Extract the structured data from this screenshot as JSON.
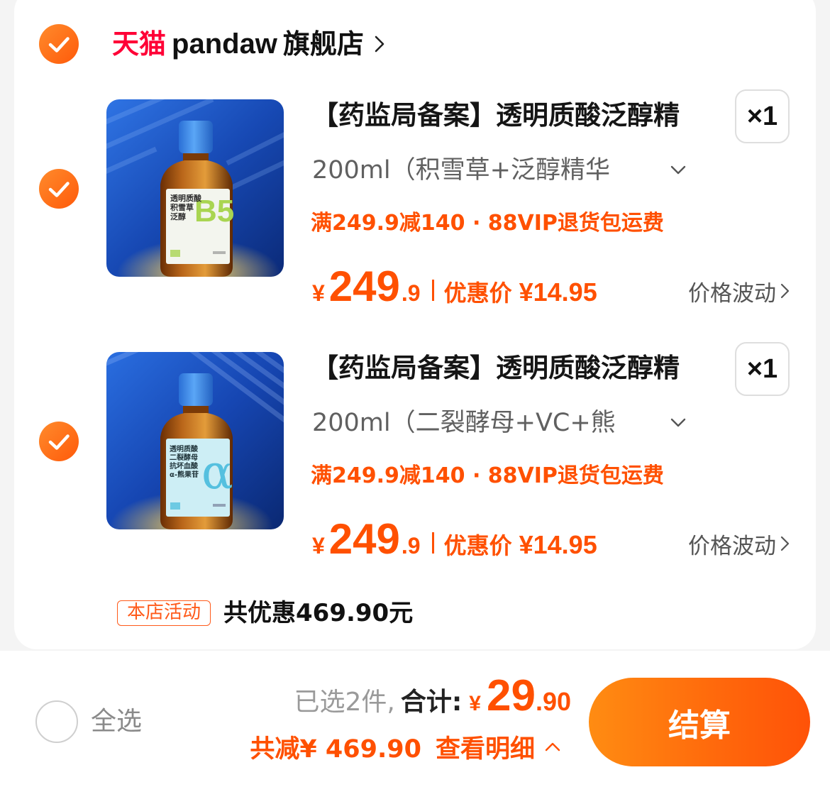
{
  "store": {
    "checked": true,
    "platform": "天猫",
    "name": "pandaw",
    "type": "旗舰店"
  },
  "items": [
    {
      "checked": true,
      "title": "【药监局备案】透明质酸泛醇精",
      "quantity": "×1",
      "spec": "200ml（积雪草+泛醇精华",
      "promo": "满249.9减140 · 88VIP退货包运费",
      "price": {
        "currency": "¥",
        "integer": "249",
        "decimal": ".9"
      },
      "discount": {
        "label": "优惠价",
        "price": "¥14.95"
      },
      "price_trend": "价格波动",
      "image_label": {
        "lines": [
          "透明质酸",
          "积雪草",
          "泛醇"
        ],
        "mark": "B5"
      }
    },
    {
      "checked": true,
      "title": "【药监局备案】透明质酸泛醇精",
      "quantity": "×1",
      "spec": "200ml（二裂酵母+VC+熊",
      "promo": "满249.9减140 · 88VIP退货包运费",
      "price": {
        "currency": "¥",
        "integer": "249",
        "decimal": ".9"
      },
      "discount": {
        "label": "优惠价",
        "price": "¥14.95"
      },
      "price_trend": "价格波动",
      "image_label": {
        "lines": [
          "透明质酸",
          "二裂酵母",
          "抗坏血酸",
          "α-熊果苷"
        ],
        "mark": "α"
      }
    }
  ],
  "store_activity": {
    "badge": "本店活动",
    "text": "共优惠469.90元"
  },
  "footer": {
    "select_all": {
      "checked": false,
      "label": "全选"
    },
    "selected_count_text": "已选2件,",
    "total_label": "合计:",
    "total": {
      "currency": "¥",
      "integer": "29",
      "decimal": ".90"
    },
    "reduction_text": "共减¥ 469.90",
    "detail_link": "查看明细",
    "checkout_label": "结算"
  },
  "icons": {
    "checkbox": "check-icon",
    "store_link": "chevron-right-icon",
    "spec_dropdown": "chevron-down-icon",
    "price_trend": "chevron-right-icon",
    "detail_toggle": "chevron-up-icon"
  },
  "colors": {
    "accent": "#ff5000",
    "tmall_red": "#ff0036",
    "text_primary": "#111111",
    "text_secondary": "#606060",
    "page_background": "#f4f4f4",
    "card_background": "#ffffff"
  }
}
